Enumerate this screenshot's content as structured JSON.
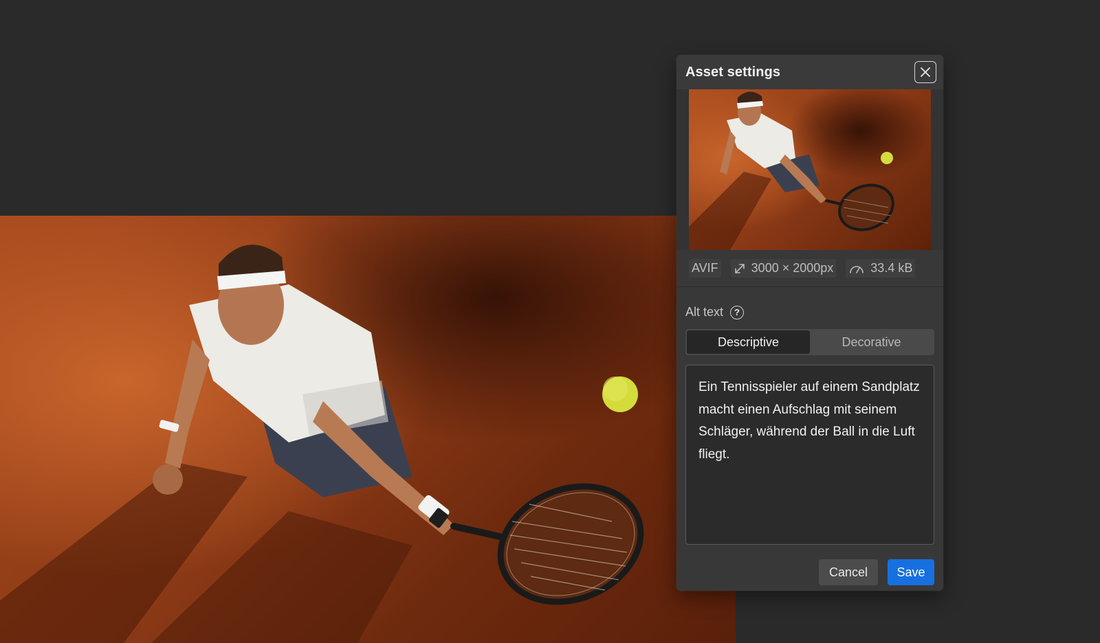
{
  "modal": {
    "title": "Asset settings",
    "close_icon": "close-icon"
  },
  "asset": {
    "format": "AVIF",
    "dimensions": "3000 × 2000px",
    "dimensions_icon": "resize-arrows-icon",
    "filesize": "33.4 kB",
    "filesize_icon": "gauge-icon"
  },
  "alt_text": {
    "label": "Alt text",
    "help_icon": "?",
    "modes": [
      "Descriptive",
      "Decorative"
    ],
    "active_mode": "Descriptive",
    "value": "Ein Tennisspieler auf einem Sandplatz macht einen Aufschlag mit seinem Schläger, während der Ball in die Luft fliegt."
  },
  "actions": {
    "cancel_label": "Cancel",
    "save_label": "Save"
  },
  "colors": {
    "background": "#2a2a2a",
    "modal": "#383838",
    "accent": "#1670e0",
    "clay": "#a84a1e",
    "ball": "#d8e04a"
  }
}
